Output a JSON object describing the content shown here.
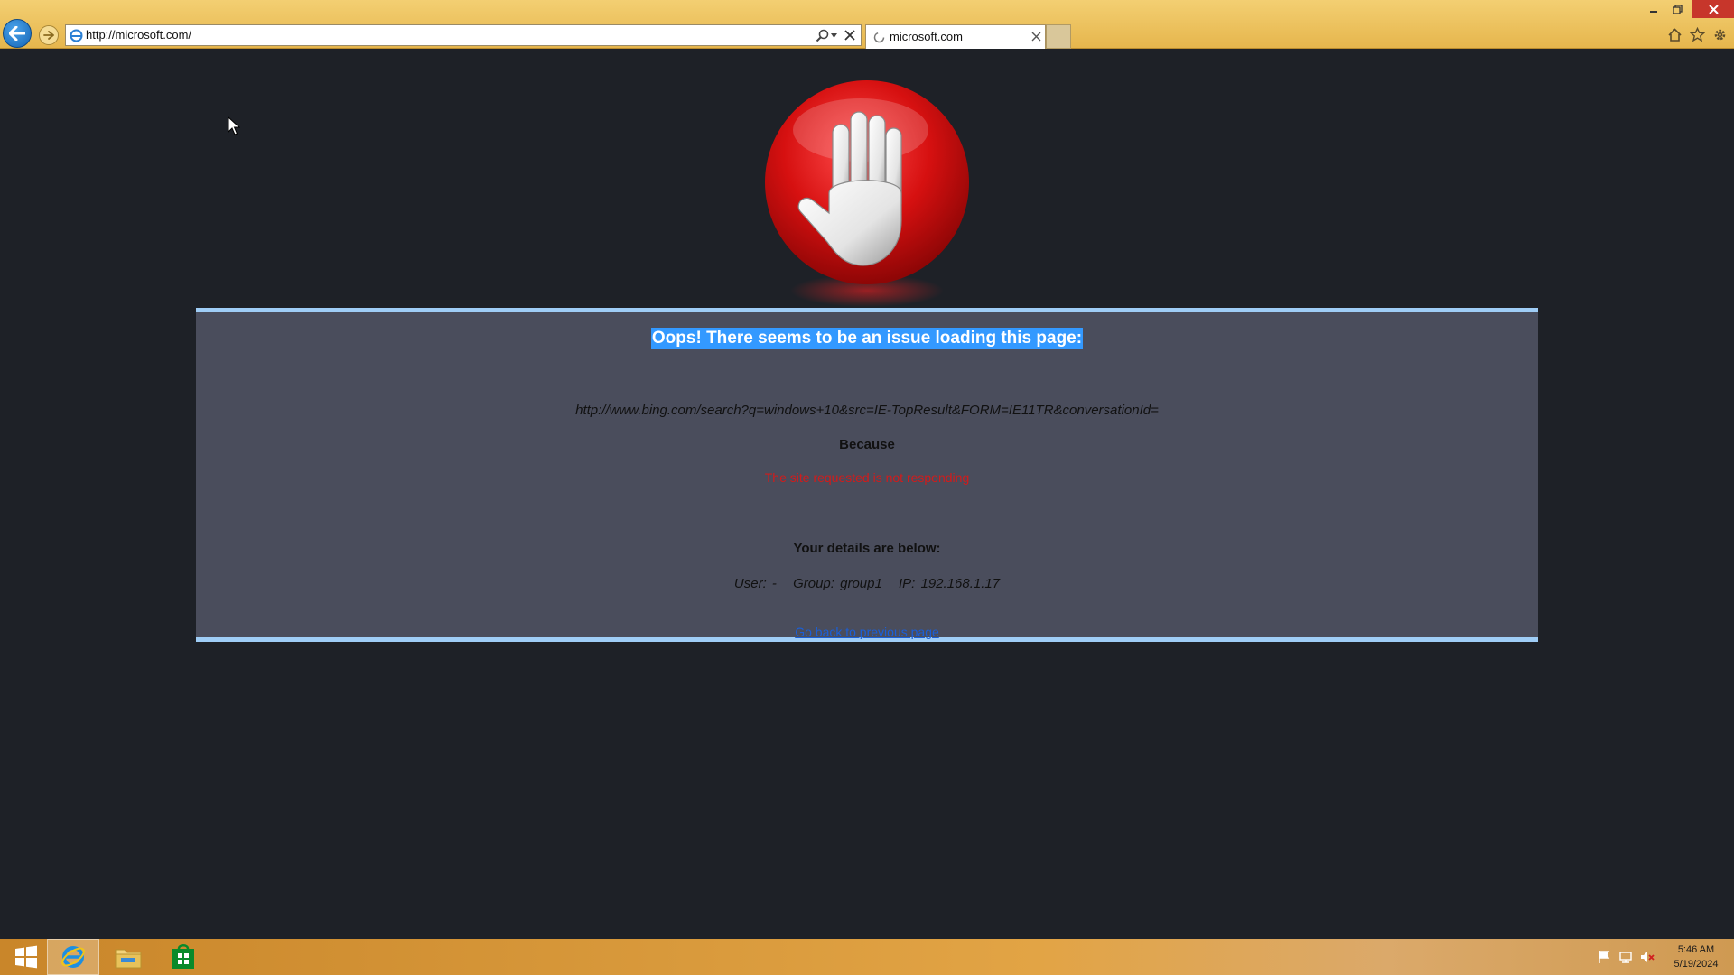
{
  "browser": {
    "address_bar": {
      "url": "http://microsoft.com/"
    },
    "tab": {
      "title": "microsoft.com"
    },
    "icons": [
      "back-icon",
      "forward-icon",
      "search-icon",
      "refresh-icon",
      "stop-icon",
      "home-icon",
      "favorites-icon",
      "tools-icon"
    ]
  },
  "page": {
    "heading": "Oops! There seems to be an issue loading this page:",
    "blocked_url": "http://www.bing.com/search?q=windows+10&src=IE-TopResult&FORM=IE11TR&conversationId=",
    "because_label": "Because",
    "reason": "The site requested is not responding",
    "details_heading": "Your details are below:",
    "details": {
      "user": "User: -",
      "group": "Group: group1",
      "ip": "IP: 192.168.1.17"
    },
    "link": "Go back to previous page",
    "colors": {
      "background": "#1e2127",
      "panel": "#4a4d5c",
      "panel_border": "#9fcdf6",
      "reason": "#d21b1b",
      "link": "#1a5fd8",
      "selection": "#3399ff"
    }
  },
  "taskbar": {
    "apps": [
      "windows-start-icon",
      "internet-explorer-icon",
      "file-explorer-icon",
      "store-icon"
    ],
    "clock": {
      "time": "5:46 AM",
      "date": "5/19/2024"
    }
  }
}
